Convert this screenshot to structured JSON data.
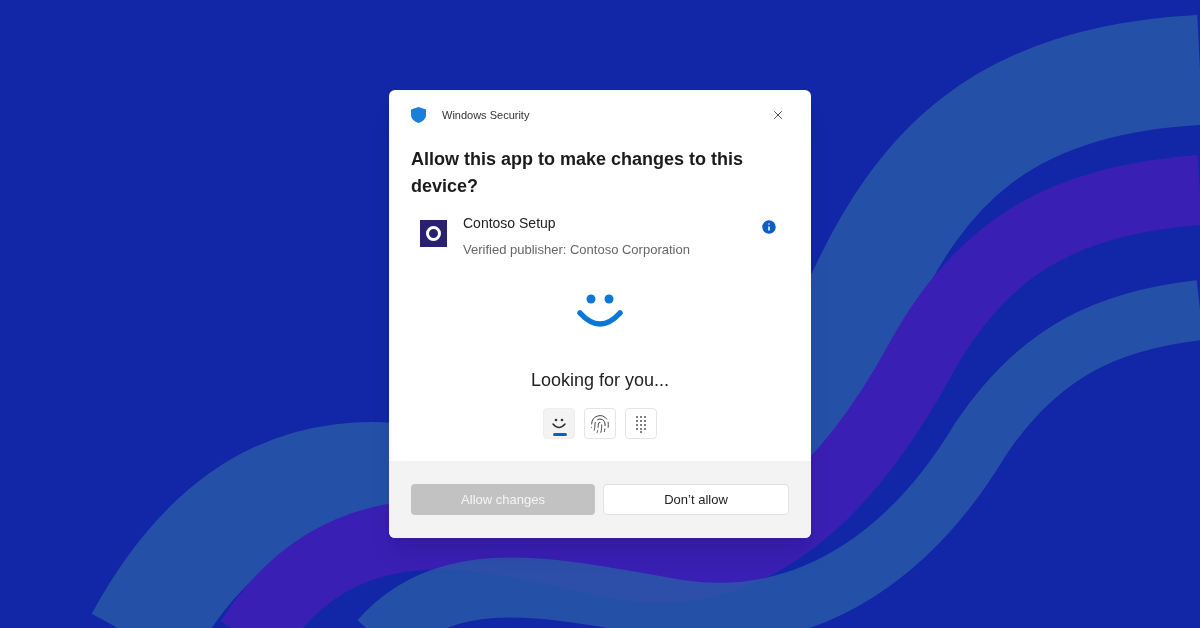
{
  "dialog": {
    "title": "Windows Security",
    "heading": "Allow this app to make changes to this device?",
    "app": {
      "name": "Contoso Setup",
      "publisher": "Verified publisher: Contoso Corporation"
    },
    "status": "Looking for you...",
    "sign_in_options": [
      {
        "kind": "face",
        "selected": true
      },
      {
        "kind": "fingerprint",
        "selected": false
      },
      {
        "kind": "pin",
        "selected": false
      }
    ],
    "buttons": [
      {
        "label": "Allow changes",
        "disabled": true
      },
      {
        "label": "Don’t allow",
        "disabled": false
      }
    ]
  }
}
